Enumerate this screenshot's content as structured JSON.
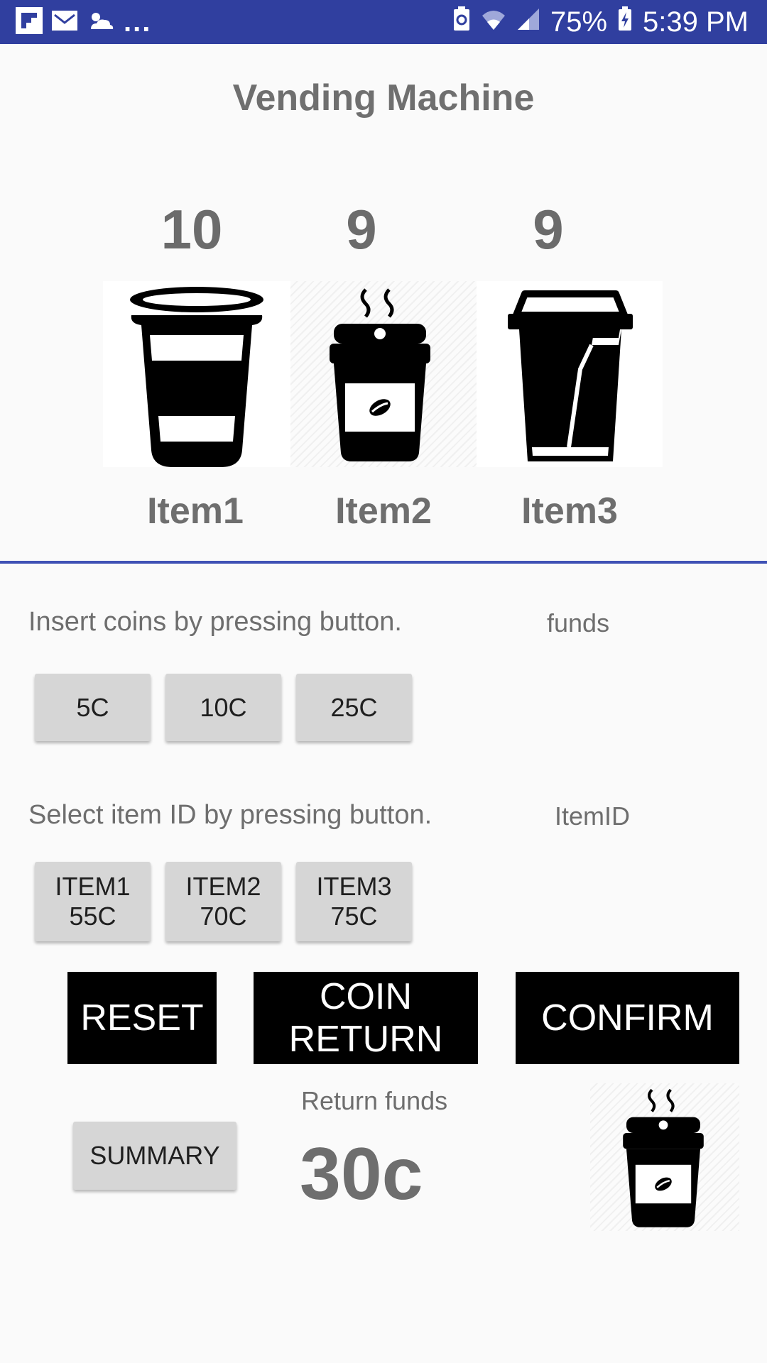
{
  "status_bar": {
    "notifications": [
      "flipboard-icon",
      "gmail-icon",
      "weather-icon"
    ],
    "more": "...",
    "battery_percent": "75%",
    "time": "5:39 PM"
  },
  "app": {
    "title": "Vending Machine"
  },
  "items": [
    {
      "count": "10",
      "label": "Item1",
      "icon": "cup-icon"
    },
    {
      "count": "9",
      "label": "Item2",
      "icon": "hot-coffee-icon"
    },
    {
      "count": "9",
      "label": "Item3",
      "icon": "takeaway-cup-icon"
    }
  ],
  "coins": {
    "instruction": "Insert coins by pressing button.",
    "funds_label": "funds",
    "buttons": [
      "5C",
      "10C",
      "25C"
    ]
  },
  "selection": {
    "instruction": "Select item ID by pressing button.",
    "itemid_label": "ItemID",
    "buttons": [
      {
        "line1": "ITEM1",
        "line2": "55C"
      },
      {
        "line1": "ITEM2",
        "line2": "70C"
      },
      {
        "line1": "ITEM3",
        "line2": "75C"
      }
    ]
  },
  "actions": {
    "reset": "RESET",
    "coin_return_line1": "COIN",
    "coin_return_line2": "RETURN",
    "confirm": "CONFIRM"
  },
  "summary": {
    "button": "SUMMARY",
    "return_label": "Return funds",
    "return_value": "30c",
    "dispensed_icon": "hot-coffee-icon"
  },
  "colors": {
    "status_bar": "#303f9f",
    "divider": "#3f51b5",
    "button_gray": "#d6d6d6"
  }
}
